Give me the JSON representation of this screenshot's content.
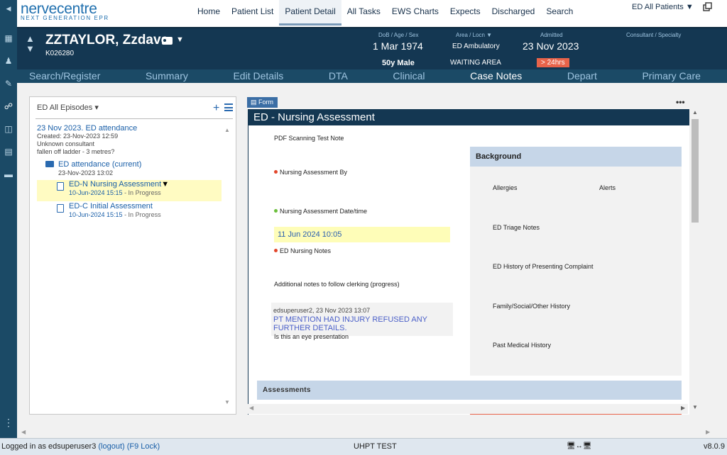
{
  "logo": {
    "brand": "nervecentre",
    "tagline": "NEXT GENERATION EPR"
  },
  "nav": {
    "items": [
      "Home",
      "Patient List",
      "Patient Detail",
      "All Tasks",
      "EWS Charts",
      "Expects",
      "Discharged",
      "Search"
    ],
    "active": "Patient Detail",
    "ward": "ED All Patients ▼"
  },
  "patient": {
    "name": "ZZTAYLOR, Zzdave",
    "number": "K026280",
    "dob_label": "DoB / Age / Sex",
    "dob": "1 Mar 1974",
    "age_sex": "50y Male",
    "area_label": "Area / Locn ▼",
    "area": "ED Ambulatory",
    "location": "WAITING AREA",
    "admitted_label": "Admitted",
    "admitted": "23 Nov 2023",
    "overdue": "> 24hrs",
    "consultant_label": "Consultant / Specialty"
  },
  "tabs": [
    "Search/Register",
    "Summary",
    "Edit Details",
    "DTA",
    "Clinical",
    "Case Notes",
    "Depart",
    "Primary Care"
  ],
  "active_tab": "Case Notes",
  "episodes": {
    "header": "ED All Episodes ▾",
    "episode": {
      "title": "23 Nov 2023. ED attendance",
      "created": "Created: 23-Nov-2023 12:59",
      "consultant": "Unknown consultant",
      "note": "fallen off ladder - 3 metres?"
    },
    "attendance": {
      "title": "ED attendance (current)",
      "date": "23-Nov-2023 13:02"
    },
    "docs": [
      {
        "title": "ED-N Nursing Assessment",
        "caret": "▼",
        "date": "10-Jun-2024 15:15",
        "status": " - In Progress",
        "selected": true
      },
      {
        "title": "ED-C Initial Assessment",
        "caret": "",
        "date": "10-Jun-2024 15:15",
        "status": " - In Progress",
        "selected": false
      }
    ]
  },
  "form": {
    "tag": "Form",
    "menu": "•••",
    "title": "ED - Nursing Assessment",
    "q_pdf": "PDF Scanning Test Note",
    "q_by": "Nursing Assessment By",
    "q_datetime": "Nursing Assessment Date/time",
    "datetime_value": "11 Jun 2024 10:05",
    "q_notes": "ED Nursing Notes",
    "q_additional": "Additional notes to follow clerking (progress)",
    "note_author": "edsuperuser2, 23 Nov 2023 13:07",
    "note_text": "PT MENTION HAD INJURY REFUSED ANY FURTHER DETAILS.",
    "q_eye": "Is this an eye presentation",
    "background": {
      "header": "Background",
      "allergies": "Allergies",
      "alerts": "Alerts",
      "triage": "ED Triage Notes",
      "history": "ED History of Presenting Complaint",
      "family": "Family/Social/Other History",
      "pmh": "Past Medical History"
    },
    "assessments": "Assessments"
  },
  "status": {
    "logged": "Logged in as edsuperuser3",
    "logout": "(logout)",
    "lock": "(F9 Lock)",
    "env": "UHPT TEST",
    "monitor": "🖥↔🖥",
    "version": "v8.0.9"
  },
  "colors": {
    "banner": "#143752",
    "rail": "#1b4a66",
    "overdue": "#e8634a",
    "link": "#1a5fa8"
  }
}
